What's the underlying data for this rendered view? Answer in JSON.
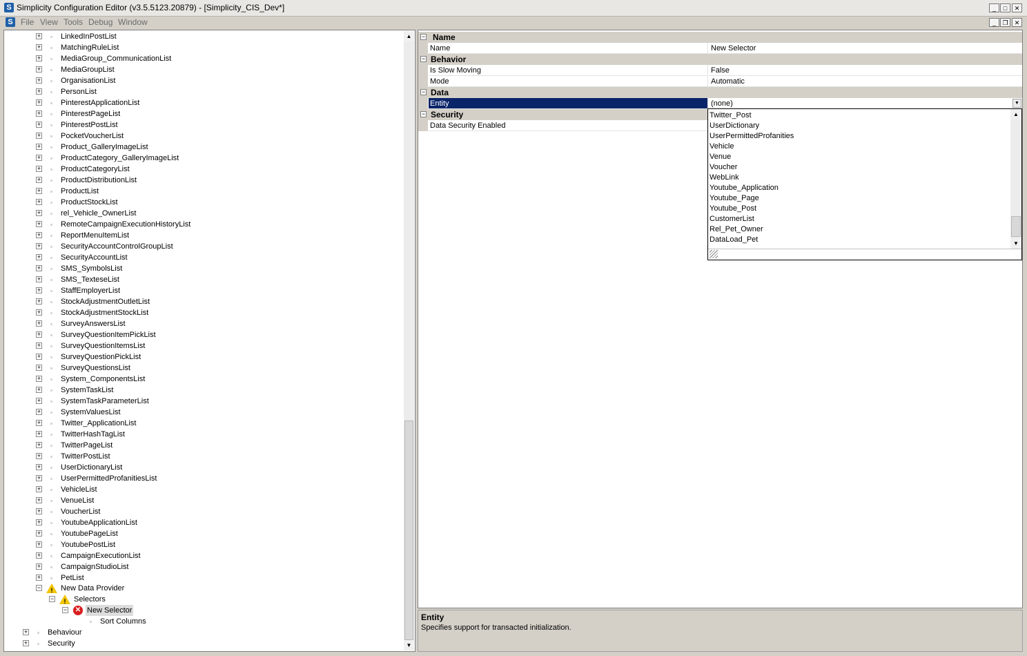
{
  "window": {
    "title": "Simplicity Configuration Editor (v3.5.5123.20879) - [Simplicity_CIS_Dev*]",
    "app_icon": "S",
    "controls": [
      "_",
      "□",
      "✕"
    ]
  },
  "menu": {
    "icon": "S",
    "items": [
      "File",
      "View",
      "Tools",
      "Debug",
      "Window"
    ],
    "mdi_controls": [
      "_",
      "❐",
      "✕"
    ]
  },
  "tree": {
    "lists": [
      "LinkedInPostList",
      "MatchingRuleList",
      "MediaGroup_CommunicationList",
      "MediaGroupList",
      "OrganisationList",
      "PersonList",
      "PinterestApplicationList",
      "PinterestPageList",
      "PinterestPostList",
      "PocketVoucherList",
      "Product_GalleryImageList",
      "ProductCategory_GalleryImageList",
      "ProductCategoryList",
      "ProductDistributionList",
      "ProductList",
      "ProductStockList",
      "rel_Vehicle_OwnerList",
      "RemoteCampaignExecutionHistoryList",
      "ReportMenuItemList",
      "SecurityAccountControlGroupList",
      "SecurityAccountList",
      "SMS_SymbolsList",
      "SMS_TexteseList",
      "StaffEmployerList",
      "StockAdjustmentOutletList",
      "StockAdjustmentStockList",
      "SurveyAnswersList",
      "SurveyQuestionItemPickList",
      "SurveyQuestionItemsList",
      "SurveyQuestionPickList",
      "SurveyQuestionsList",
      "System_ComponentsList",
      "SystemTaskList",
      "SystemTaskParameterList",
      "SystemValuesList",
      "Twitter_ApplicationList",
      "TwitterHashTagList",
      "TwitterPageList",
      "TwitterPostList",
      "UserDictionaryList",
      "UserPermittedProfanitiesList",
      "VehicleList",
      "VenueList",
      "VoucherList",
      "YoutubeApplicationList",
      "YoutubePageList",
      "YoutubePostList",
      "CampaignExecutionList",
      "CampaignStudioList",
      "PetList"
    ],
    "new_data_provider": "New Data Provider",
    "selectors": "Selectors",
    "new_selector": "New Selector",
    "sort_columns": "Sort Columns",
    "behaviour": "Behaviour",
    "security": "Security",
    "expand_glyph": "+",
    "collapse_glyph": "−"
  },
  "properties": {
    "categories": {
      "name": "Name",
      "behavior": "Behavior",
      "data": "Data",
      "security": "Security"
    },
    "rows": {
      "name": {
        "label": "Name",
        "value": "New Selector"
      },
      "is_slow_moving": {
        "label": "Is Slow Moving",
        "value": "False"
      },
      "mode": {
        "label": "Mode",
        "value": "Automatic"
      },
      "entity": {
        "label": "Entity",
        "value": "(none)"
      },
      "data_security_enabled": {
        "label": "Data Security Enabled",
        "value": ""
      }
    }
  },
  "entity_dropdown": {
    "options": [
      "Twitter_Post",
      "UserDictionary",
      "UserPermittedProfanities",
      "Vehicle",
      "Venue",
      "Voucher",
      "WebLink",
      "Youtube_Application",
      "Youtube_Page",
      "Youtube_Post",
      "CustomerList",
      "Rel_Pet_Owner",
      "DataLoad_Pet"
    ]
  },
  "description": {
    "title": "Entity",
    "text": "Specifies support for transacted initialization."
  },
  "colors": {
    "selection": "#0a246a",
    "warning": "#f2c500",
    "error": "#d91e1e",
    "chrome": "#d4d0c8"
  }
}
